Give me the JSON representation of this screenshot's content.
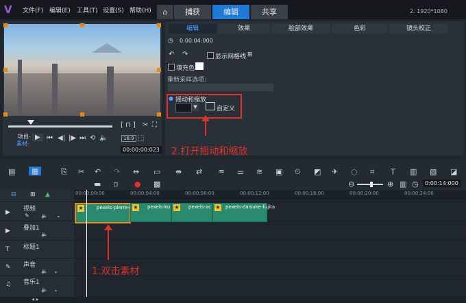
{
  "menu": [
    "文件(F)",
    "编辑(E)",
    "工具(T)",
    "设置(S)",
    "帮助(H)"
  ],
  "tabs": {
    "capture": "捕获",
    "edit": "编辑",
    "share": "共享"
  },
  "resolution": "2. 1920*1080",
  "preview": {
    "project_label": "项目-",
    "clip_label": "素材-",
    "timecode": "00:00:00:023",
    "ratio": "16:9"
  },
  "options": {
    "tabs": [
      "编辑",
      "效果",
      "脸部效果",
      "色彩",
      "镜头校正"
    ],
    "duration": "0:00:04:000",
    "show_grid": "显示网格线",
    "fill_color": "填充色",
    "resample": "重新采样选项:",
    "pan_zoom": "摇动和缩放",
    "custom": "自定义"
  },
  "annotations": {
    "step1": "1.双击素材",
    "step2": "2.打开摇动和缩放",
    "color": "#e0312b"
  },
  "toolbar": {
    "zoom_timecode": "0:00:14:000"
  },
  "ruler": [
    "00:00:00:00",
    "00:00:04:00",
    "00:00:08:00",
    "00:00:12:00",
    "00:00:16:00",
    "00:00:20:00",
    "00:00:24:00"
  ],
  "tracks": [
    "视频",
    "叠加1",
    "标题1",
    "声音",
    "音乐1"
  ],
  "clips": [
    "pexels-pierre-l",
    "pexels-ku",
    "pexels-ac",
    "pexels-daisuke-fujita"
  ]
}
